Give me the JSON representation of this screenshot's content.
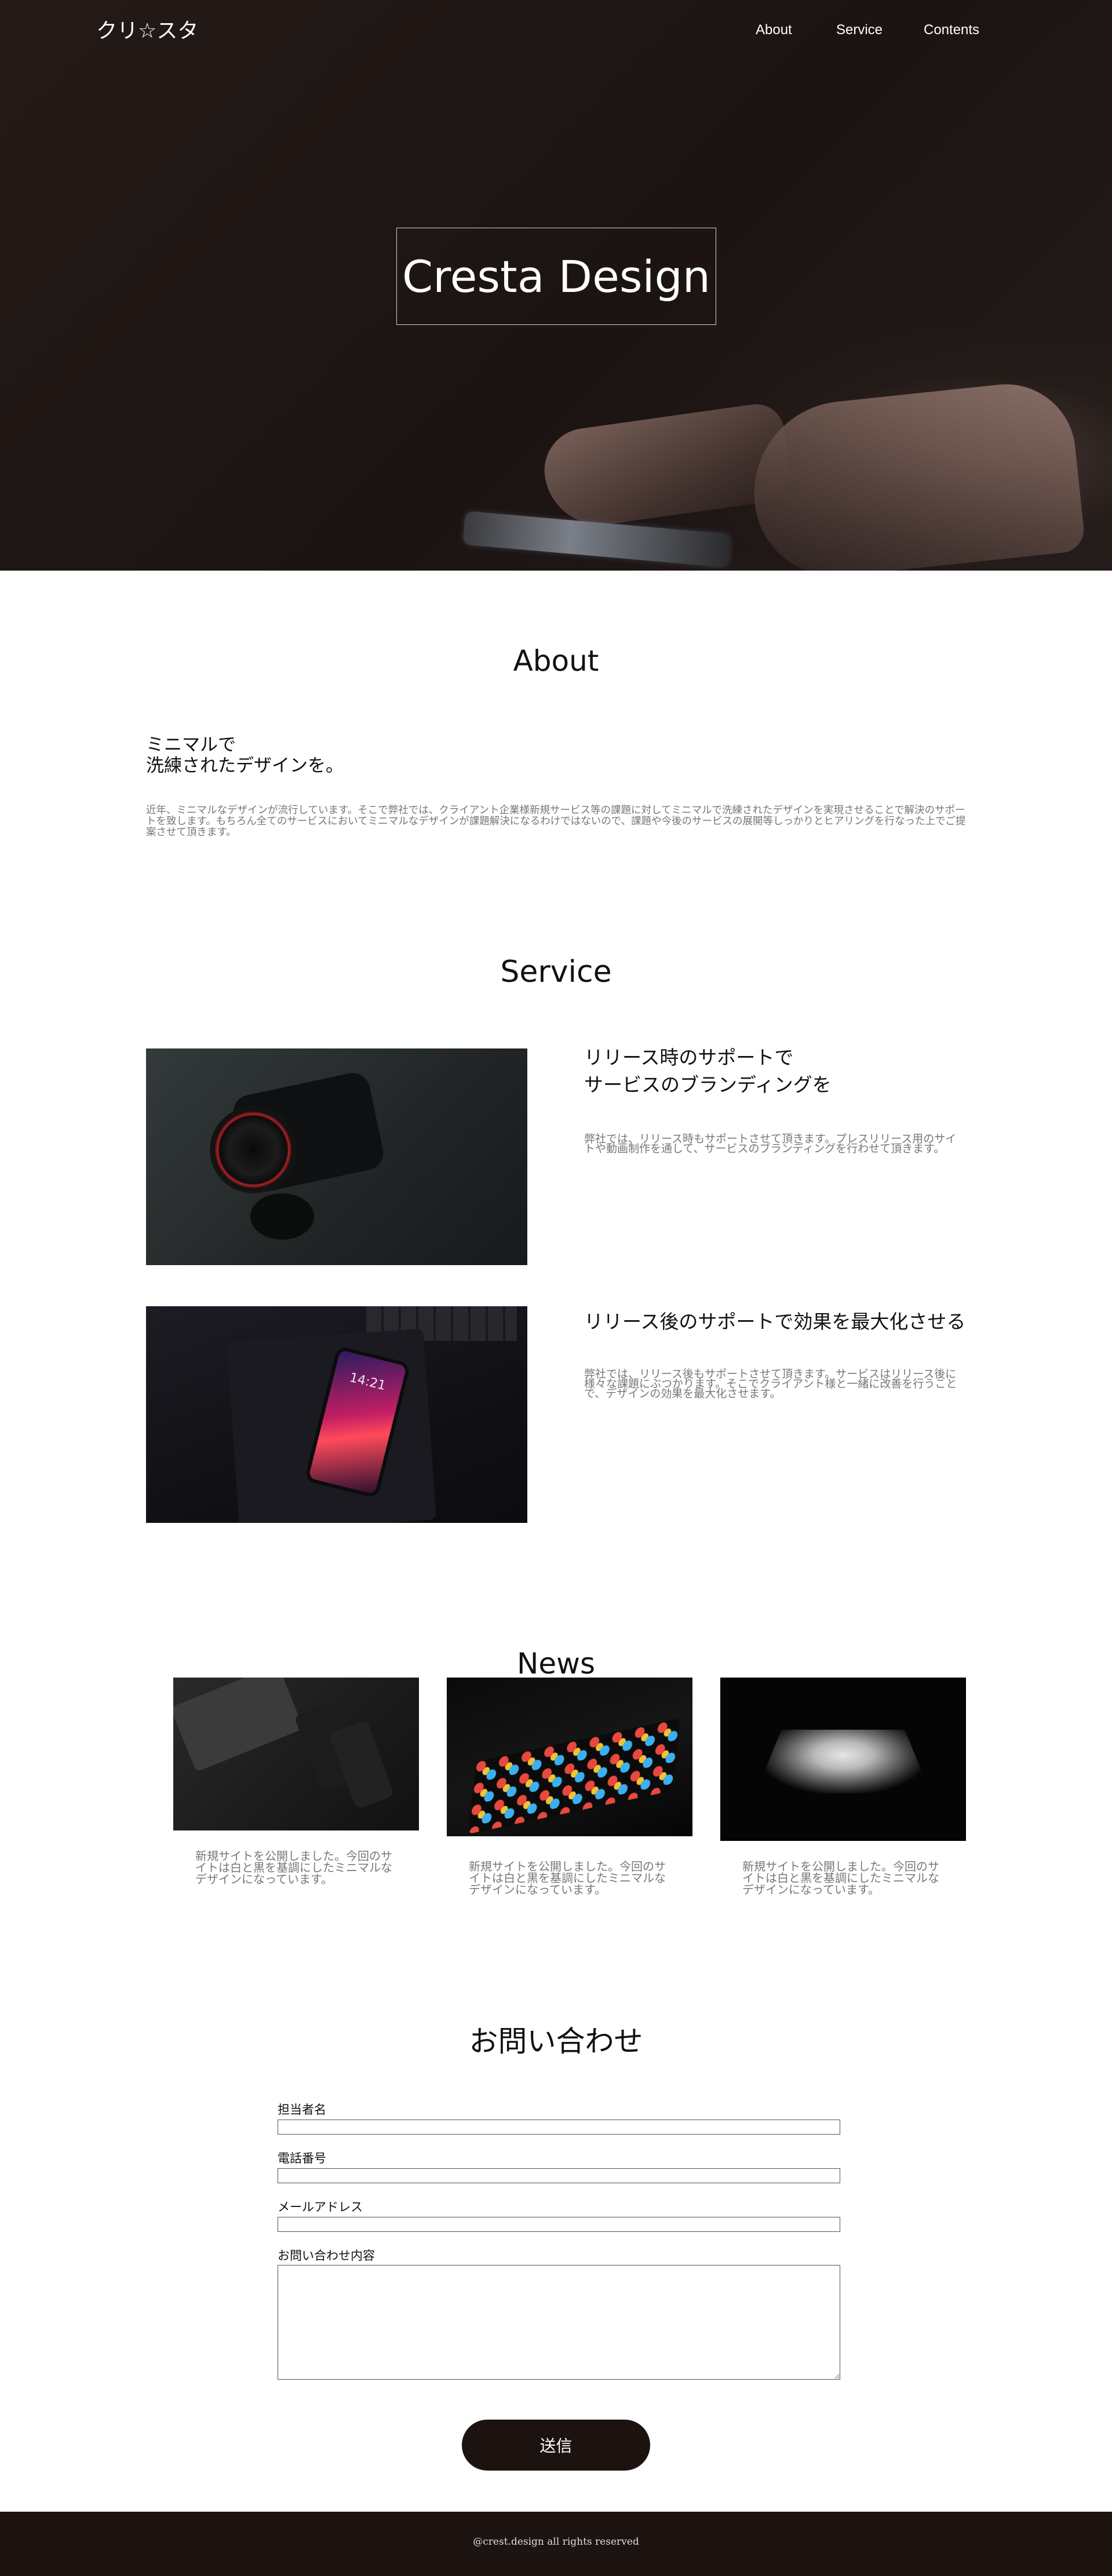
{
  "header": {
    "logo": "クリ☆スタ",
    "nav": [
      "About",
      "Service",
      "Contents"
    ]
  },
  "hero": {
    "title": "Cresta Design"
  },
  "about": {
    "title": "About",
    "heading": "ミニマルで\n洗練されたデザインを。",
    "body": "近年、ミニマルなデザインが流行しています。そこで弊社では、クライアント企業様新規サービス等の課題に対してミニマルで洗練されたデザインを実現させることで解決のサポートを致します。もちろん全てのサービスにおいてミニマルなデザインが課題解決になるわけではないので、課題や今後のサービスの展開等しっかりとヒアリングを行なった上でご提案させて頂きます。"
  },
  "service": {
    "title": "Service",
    "items": [
      {
        "heading": "リリース時のサポートで\nサービスのブランディングを",
        "body": "弊社では、リリース時もサポートさせて頂きます。プレスリリース用のサイトや動画制作を通して、サービスのブランディングを行わせて頂きます。",
        "image": "camera-photo"
      },
      {
        "heading": "リリース後のサポートで効果を最大化させる",
        "body": "弊社では、リリース後もサポートさせて頂きます。サービスはリリース後に様々な課題にぶつかります。そこでクライアント様と一緒に改善を行うことで、デザインの効果を最大化させます。",
        "image": "smartphone-photo",
        "phone_time": "14:21"
      }
    ]
  },
  "news": {
    "title": "News",
    "items": [
      {
        "text": "新規サイトを公開しました。今回のサイトは白と黒を基調にしたミニマルなデザインになっています。",
        "image": "devices-photo"
      },
      {
        "text": "新規サイトを公開しました。今回のサイトは白と黒を基調にしたミニマルなデザインになっています。",
        "image": "app-screen-photo"
      },
      {
        "text": "新規サイトを公開しました。今回のサイトは白と黒を基調にしたミニマルなデザインになっています。",
        "image": "laptop-photo"
      }
    ]
  },
  "contact": {
    "title": "お問い合わせ",
    "fields": {
      "name": {
        "label": "担当者名",
        "value": ""
      },
      "tel": {
        "label": "電話番号",
        "value": ""
      },
      "mail": {
        "label": "メールアドレス",
        "value": ""
      },
      "message": {
        "label": "お問い合わせ内容",
        "value": ""
      }
    },
    "submit_label": "送信"
  },
  "footer": {
    "copyright": "@crest.design all rights reserved"
  },
  "colors": {
    "hero_bg": "#1f1715",
    "button_bg": "#1c1210",
    "footer_bg": "#1d1411",
    "body_text": "#777777"
  }
}
